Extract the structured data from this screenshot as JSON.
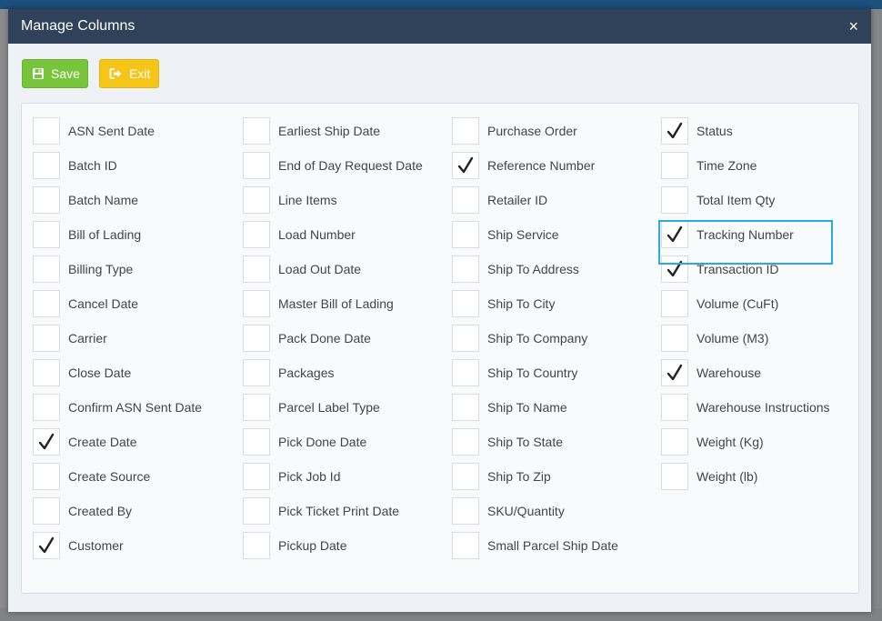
{
  "modal": {
    "title": "Manage Columns",
    "close_glyph": "×",
    "save_label": "Save",
    "exit_label": "Exit",
    "save_icon": "save-icon",
    "exit_icon": "exit-icon"
  },
  "colors": {
    "header": "#2f4259",
    "save": "#78c43a",
    "exit": "#f5c518",
    "highlight": "#29abe2"
  },
  "columns": [
    [
      {
        "label": "ASN Sent Date",
        "checked": false
      },
      {
        "label": "Batch ID",
        "checked": false
      },
      {
        "label": "Batch Name",
        "checked": false
      },
      {
        "label": "Bill of Lading",
        "checked": false
      },
      {
        "label": "Billing Type",
        "checked": false
      },
      {
        "label": "Cancel Date",
        "checked": false
      },
      {
        "label": "Carrier",
        "checked": false
      },
      {
        "label": "Close Date",
        "checked": false
      },
      {
        "label": "Confirm ASN Sent Date",
        "checked": false
      },
      {
        "label": "Create Date",
        "checked": true
      },
      {
        "label": "Create Source",
        "checked": false
      },
      {
        "label": "Created By",
        "checked": false
      },
      {
        "label": "Customer",
        "checked": true
      }
    ],
    [
      {
        "label": "Earliest Ship Date",
        "checked": false
      },
      {
        "label": "End of Day Request Date",
        "checked": false
      },
      {
        "label": "Line Items",
        "checked": false
      },
      {
        "label": "Load Number",
        "checked": false
      },
      {
        "label": "Load Out Date",
        "checked": false
      },
      {
        "label": "Master Bill of Lading",
        "checked": false
      },
      {
        "label": "Pack Done Date",
        "checked": false
      },
      {
        "label": "Packages",
        "checked": false
      },
      {
        "label": "Parcel Label Type",
        "checked": false
      },
      {
        "label": "Pick Done Date",
        "checked": false
      },
      {
        "label": "Pick Job Id",
        "checked": false
      },
      {
        "label": "Pick Ticket Print Date",
        "checked": false
      },
      {
        "label": "Pickup Date",
        "checked": false
      }
    ],
    [
      {
        "label": "Purchase Order",
        "checked": false
      },
      {
        "label": "Reference Number",
        "checked": true
      },
      {
        "label": "Retailer ID",
        "checked": false
      },
      {
        "label": "Ship Service",
        "checked": false
      },
      {
        "label": "Ship To Address",
        "checked": false
      },
      {
        "label": "Ship To City",
        "checked": false
      },
      {
        "label": "Ship To Company",
        "checked": false
      },
      {
        "label": "Ship To Country",
        "checked": false
      },
      {
        "label": "Ship To Name",
        "checked": false
      },
      {
        "label": "Ship To State",
        "checked": false
      },
      {
        "label": "Ship To Zip",
        "checked": false
      },
      {
        "label": "SKU/Quantity",
        "checked": false
      },
      {
        "label": "Small Parcel Ship Date",
        "checked": false
      }
    ],
    [
      {
        "label": "Status",
        "checked": true
      },
      {
        "label": "Time Zone",
        "checked": false
      },
      {
        "label": "Total Item Qty",
        "checked": false
      },
      {
        "label": "Tracking Number",
        "checked": true,
        "highlighted": true
      },
      {
        "label": "Transaction ID",
        "checked": true
      },
      {
        "label": "Volume (CuFt)",
        "checked": false
      },
      {
        "label": "Volume (M3)",
        "checked": false
      },
      {
        "label": "Warehouse",
        "checked": true
      },
      {
        "label": "Warehouse Instructions",
        "checked": false
      },
      {
        "label": "Weight (Kg)",
        "checked": false
      },
      {
        "label": "Weight (lb)",
        "checked": false
      }
    ]
  ]
}
